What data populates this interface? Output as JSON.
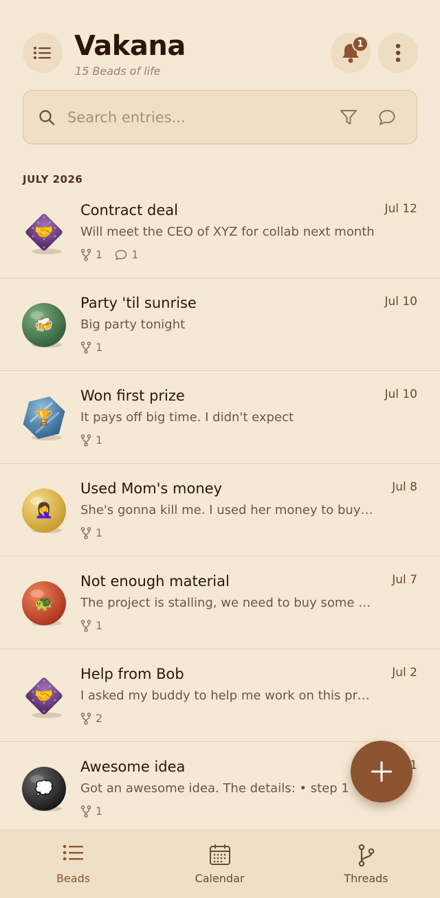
{
  "header": {
    "title": "Vakana",
    "subtitle": "15 Beads of life",
    "notification_count": "1"
  },
  "search": {
    "placeholder": "Search entries..."
  },
  "section": {
    "label": "JULY 2026"
  },
  "entries": [
    {
      "title": "Contract deal",
      "date": "Jul 12",
      "preview": "Will meet the CEO of XYZ for collab next month",
      "threads": "1",
      "comments": "1",
      "emoji": "🤝",
      "bead": "diamond-purple"
    },
    {
      "title": "Party 'til sunrise",
      "date": "Jul 10",
      "preview": "Big party tonight",
      "threads": "1",
      "emoji": "🍻",
      "bead": "round-green"
    },
    {
      "title": "Won first prize",
      "date": "Jul 10",
      "preview": "It pays off big time. I didn't expect",
      "threads": "1",
      "emoji": "🏆",
      "bead": "hex-blue"
    },
    {
      "title": "Used Mom's money",
      "date": "Jul 8",
      "preview": "She's gonna kill me. I used her money to buy something",
      "threads": "1",
      "emoji": "🤦‍♀️",
      "bead": "round-gold"
    },
    {
      "title": "Not enough material",
      "date": "Jul 7",
      "preview": "The project is stalling, we need to buy some more",
      "threads": "1",
      "emoji": "🐢",
      "bead": "round-red"
    },
    {
      "title": "Help from Bob",
      "date": "Jul 2",
      "preview": "I asked my buddy to help me work on this project",
      "threads": "2",
      "emoji": "🤝",
      "bead": "diamond-purple"
    },
    {
      "title": "Awesome idea",
      "date": "Jul 1",
      "preview": "Got an awesome idea. The details:  •  step 1",
      "threads": "1",
      "emoji": "💭",
      "bead": "round-black"
    }
  ],
  "nav": {
    "beads": "Beads",
    "calendar": "Calendar",
    "threads": "Threads"
  },
  "colors": {
    "background": "#f5e8d4",
    "accent": "#8c5430",
    "text": "#2a170a"
  }
}
